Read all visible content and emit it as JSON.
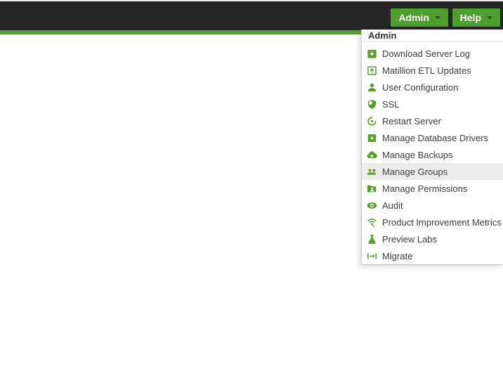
{
  "topbar": {
    "admin_button": {
      "label": "Admin"
    },
    "help_button": {
      "label": "Help"
    }
  },
  "admin_menu": {
    "header": "Admin",
    "items": [
      {
        "label": "Download Server Log",
        "icon": "download-server-log-icon",
        "highlighted": false
      },
      {
        "label": "Matillion ETL Updates",
        "icon": "matillion-etl-updates-icon",
        "highlighted": false
      },
      {
        "label": "User Configuration",
        "icon": "user-configuration-icon",
        "highlighted": false
      },
      {
        "label": "SSL",
        "icon": "ssl-icon",
        "highlighted": false
      },
      {
        "label": "Restart Server",
        "icon": "restart-server-icon",
        "highlighted": false
      },
      {
        "label": "Manage Database Drivers",
        "icon": "manage-database-drivers-icon",
        "highlighted": false
      },
      {
        "label": "Manage Backups",
        "icon": "manage-backups-icon",
        "highlighted": false
      },
      {
        "label": "Manage Groups",
        "icon": "manage-groups-icon",
        "highlighted": true
      },
      {
        "label": "Manage Permissions",
        "icon": "manage-permissions-icon",
        "highlighted": false
      },
      {
        "label": "Audit",
        "icon": "audit-icon",
        "highlighted": false
      },
      {
        "label": "Product Improvement Metrics",
        "icon": "product-improvement-metrics-icon",
        "highlighted": false
      },
      {
        "label": "Preview Labs",
        "icon": "preview-labs-icon",
        "highlighted": false
      },
      {
        "label": "Migrate",
        "icon": "migrate-icon",
        "highlighted": false
      }
    ]
  },
  "colors": {
    "topbar_background": "#242424",
    "brand_green_button": "#4d9e2c",
    "brand_green_strip": "#5a9e33",
    "icon_green": "#56a028",
    "menu_text": "#404040",
    "menu_highlight": "#ececec"
  }
}
